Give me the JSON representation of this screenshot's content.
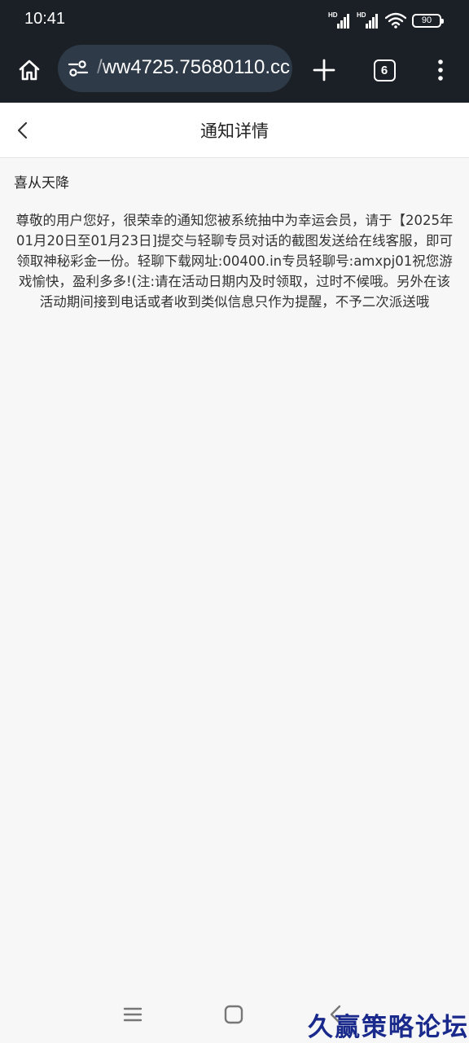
{
  "status_bar": {
    "time": "10:41",
    "network_label_1": "HD",
    "network_label_2": "HD",
    "battery": "90",
    "icons": [
      "signal-icon",
      "signal-icon",
      "wifi-icon",
      "battery-icon"
    ]
  },
  "browser": {
    "url": "/ww4725.75680110.cc",
    "tab_count": "6",
    "icons": [
      "home-icon",
      "site-settings-icon",
      "plus-icon",
      "tabs-icon",
      "more-vert-icon"
    ]
  },
  "header": {
    "title": "通知详情",
    "back_icon": "chevron-left-icon"
  },
  "notice": {
    "title": "喜从天降",
    "body": "尊敬的用户您好，很荣幸的通知您被系统抽中为幸运会员，请于【2025年01月20日至01月23日]提交与轻聊专员对话的截图发送给在线客服，即可领取神秘彩金一份。轻聊下载网址:00400.in专员轻聊号:amxpj01祝您游戏愉快，盈利多多!(注:请在活动日期内及时领取，过时不候哦。另外在该活动期间接到电话或者收到类似信息只作为提醒，不予二次派送哦"
  },
  "nav": {
    "icons": [
      "menu-icon",
      "home-square-icon",
      "back-icon"
    ]
  },
  "watermark": "久赢策略论坛",
  "colors": {
    "browser_bg": "#1b2027",
    "url_pill": "#2e3a47",
    "page_bg": "#f7f7f7",
    "watermark": "#1a2a8c"
  }
}
